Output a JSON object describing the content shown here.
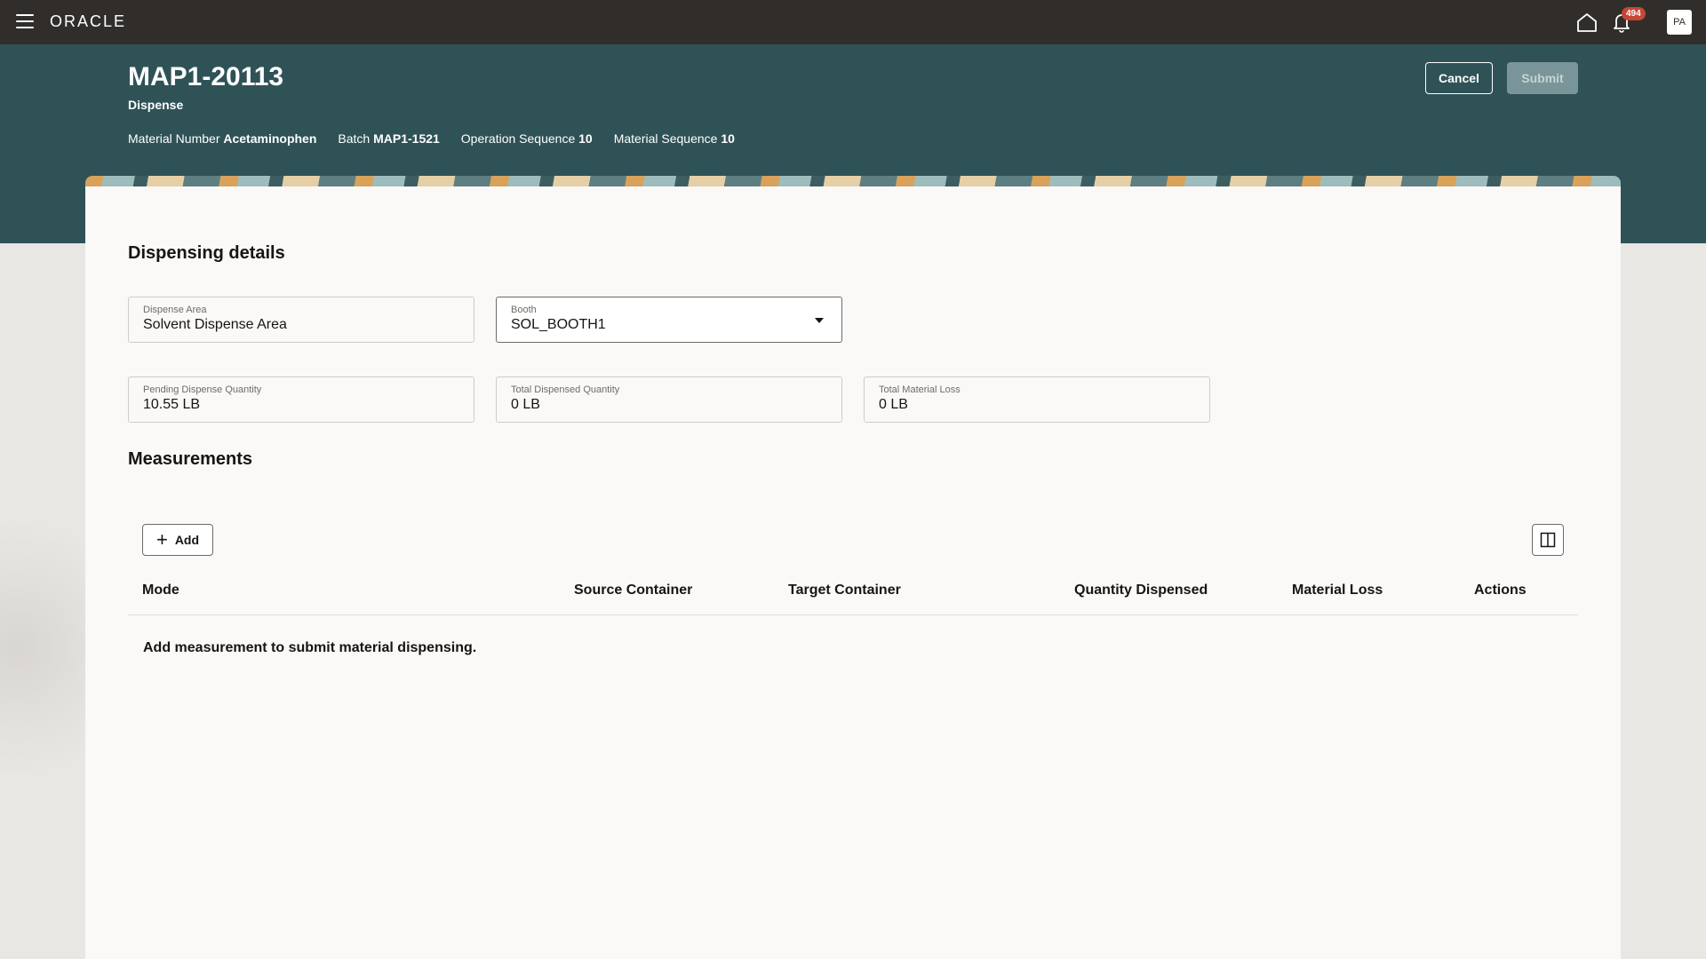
{
  "topbar": {
    "logo": "ORACLE",
    "notification_count": "494",
    "avatar_initials": "PA"
  },
  "header": {
    "title": "MAP1-20113",
    "subtitle": "Dispense",
    "meta": [
      {
        "label": "Material Number",
        "value": "Acetaminophen"
      },
      {
        "label": "Batch",
        "value": "MAP1-1521"
      },
      {
        "label": "Operation Sequence",
        "value": "10"
      },
      {
        "label": "Material Sequence",
        "value": "10"
      }
    ],
    "cancel_label": "Cancel",
    "submit_label": "Submit"
  },
  "dispensing": {
    "title": "Dispensing details",
    "dispense_area": {
      "label": "Dispense Area",
      "value": "Solvent Dispense Area"
    },
    "booth": {
      "label": "Booth",
      "value": "SOL_BOOTH1"
    },
    "pending_qty": {
      "label": "Pending Dispense Quantity",
      "value": "10.55 LB"
    },
    "total_dispensed": {
      "label": "Total Dispensed Quantity",
      "value": "0 LB"
    },
    "total_loss": {
      "label": "Total Material Loss",
      "value": "0 LB"
    }
  },
  "measurements": {
    "title": "Measurements",
    "add_label": "Add",
    "columns": [
      "Mode",
      "Source Container",
      "Target Container",
      "Quantity Dispensed",
      "Material Loss",
      "Actions"
    ],
    "empty_message": "Add measurement to submit material dispensing."
  },
  "colors": {
    "topbar": "#312d2a",
    "header_band": "#2f5257",
    "badge": "#c74634"
  }
}
